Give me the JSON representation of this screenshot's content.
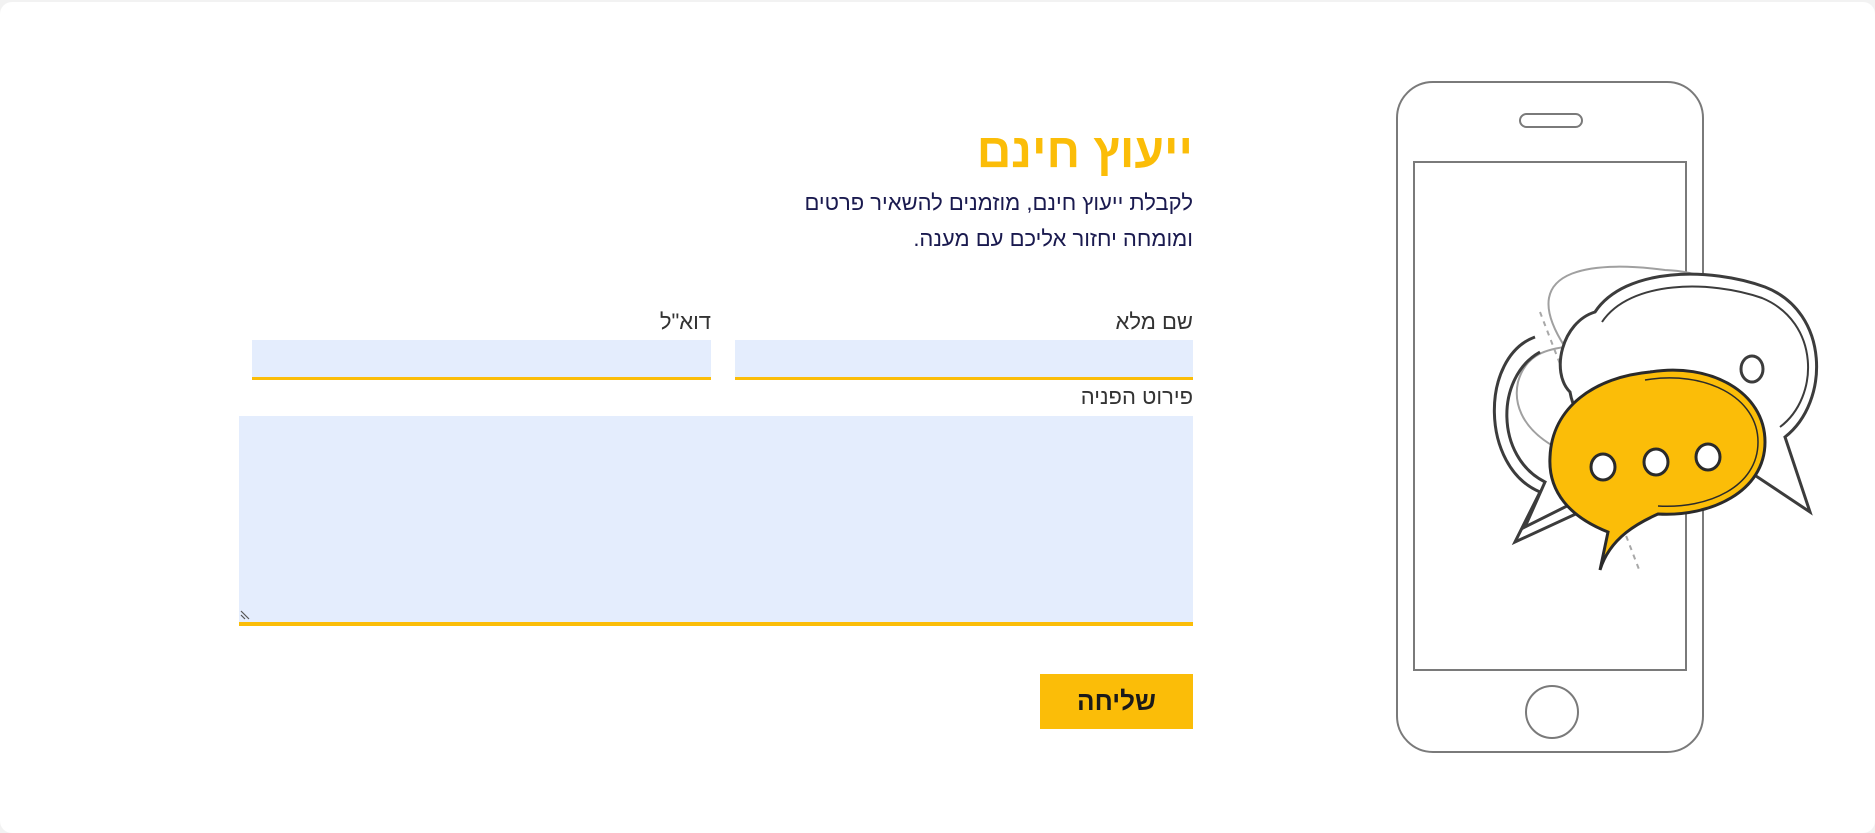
{
  "form": {
    "title": "ייעוץ חינם",
    "subtitle": "לקבלת ייעוץ חינם, מוזמנים להשאיר פרטים ומומחה יחזור אליכם עם מענה.",
    "fields": {
      "full_name": {
        "label": "שם מלא",
        "value": "",
        "placeholder": ""
      },
      "email": {
        "label": "דוא\"ל",
        "value": "",
        "placeholder": ""
      },
      "details": {
        "label": "פירוט הפניה",
        "value": "",
        "placeholder": ""
      }
    },
    "submit_label": "שליחה"
  },
  "illustration": {
    "icons": [
      "smartphone-icon",
      "chat-bubbles-icon"
    ]
  },
  "colors": {
    "accent": "#fbbd08",
    "field_background": "#e4edfd",
    "text_dark_blue": "#1a1a4f",
    "label_text": "#333333",
    "outline": "#3c3c3c"
  }
}
